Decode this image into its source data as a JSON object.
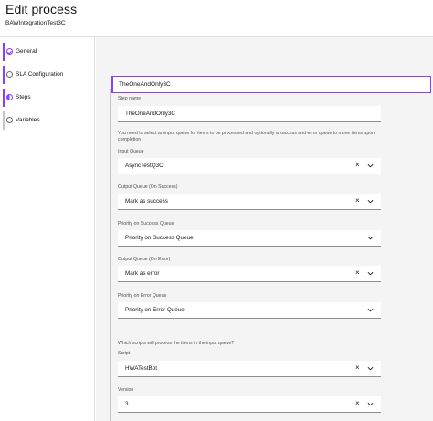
{
  "header": {
    "title": "Edit process",
    "subtitle": "BAWIntegrationTest3C"
  },
  "sidebar": {
    "items": [
      {
        "label": "General",
        "state": "complete"
      },
      {
        "label": "SLA Configuration",
        "state": "incomplete"
      },
      {
        "label": "Steps",
        "state": "current"
      },
      {
        "label": "Variables",
        "state": "incomplete"
      }
    ]
  },
  "step_tile": {
    "label": "TheOneAndOnly3C"
  },
  "form": {
    "step_name": {
      "label": "Step name",
      "value": "TheOneAndOnly3C"
    },
    "queue_help": "You need to select an input queue for items to be processed and optionally a success and error queue to move items upon completion",
    "input_queue": {
      "label": "Input Queue",
      "value": "AsyncTestQ3C"
    },
    "output_success": {
      "label": "Output Queue (On Success)",
      "value": "Mark as success"
    },
    "priority_success": {
      "label": "Priority on Success Queue",
      "value": "Priority on Success Queue"
    },
    "output_error": {
      "label": "Output Queue (On Error)",
      "value": "Mark as error"
    },
    "priority_error": {
      "label": "Priority on Error Queue",
      "value": "Priority on Error Queue"
    },
    "script_help": "Which scripts will process the items in the input queue?",
    "script": {
      "label": "Script",
      "value": "HWATestBot"
    },
    "version": {
      "label": "Version",
      "value": "3"
    }
  },
  "colors": {
    "accent": "#8a3ffc",
    "background": "#f4f4f4"
  },
  "icons": {
    "clear": "close-icon",
    "expand": "chevron-down-icon"
  }
}
